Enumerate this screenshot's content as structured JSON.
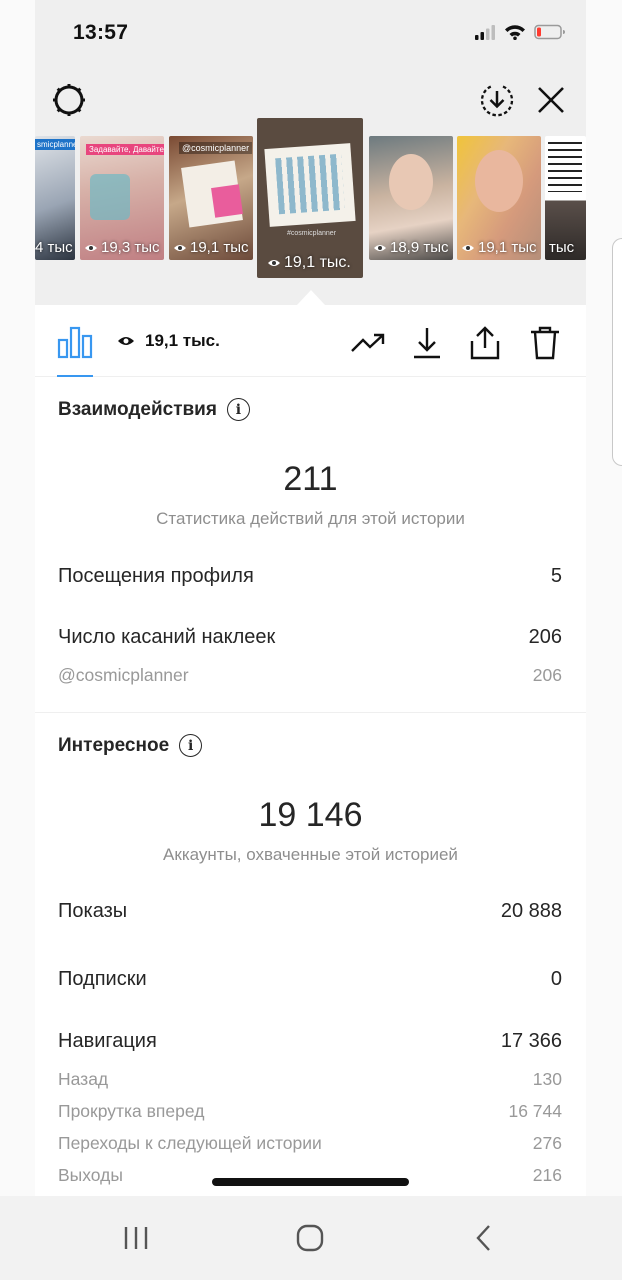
{
  "status_bar": {
    "time": "13:57"
  },
  "icons": {
    "settings": "settings-gear-icon",
    "download_circle": "download-circle-icon",
    "close": "close-icon",
    "signal": "signal-icon",
    "wifi": "wifi-icon",
    "battery": "battery-icon",
    "eye": "eye-icon"
  },
  "thumbnails": [
    {
      "views": "4 тыс",
      "thumb_text": "smicplanner"
    },
    {
      "views": "19,3 тыс",
      "thumb_text": "Задавайте, Давайте!"
    },
    {
      "views": "19,1 тыс",
      "thumb_text": "@cosmicplanner"
    },
    {
      "views": "19,1 тыс.",
      "thumb_text": "#cosmicplanner",
      "selected": true
    },
    {
      "views": "18,9 тыс"
    },
    {
      "views": "19,1 тыс"
    },
    {
      "views": "тыс"
    }
  ],
  "toolbar": {
    "views": "19,1 тыс."
  },
  "interactions": {
    "title": "Взаимодействия",
    "value": "211",
    "caption": "Статистика действий для этой истории",
    "rows": [
      {
        "label": "Посещения профиля",
        "value": "5"
      },
      {
        "label": "Число касаний наклеек",
        "value": "206"
      }
    ],
    "sub_rows": [
      {
        "label": "@cosmicplanner",
        "value": "206"
      }
    ]
  },
  "discovery": {
    "title": "Интересное",
    "value": "19 146",
    "caption": "Аккаунты, охваченные этой историей",
    "rows": [
      {
        "label": "Показы",
        "value": "20 888"
      },
      {
        "label": "Подписки",
        "value": "0"
      },
      {
        "label": "Навигация",
        "value": "17 366"
      }
    ],
    "sub_rows": [
      {
        "label": "Назад",
        "value": "130"
      },
      {
        "label": "Прокрутка вперед",
        "value": "16 744"
      },
      {
        "label": "Переходы к следующей истории",
        "value": "276"
      },
      {
        "label": "Выходы",
        "value": "216"
      }
    ]
  },
  "colors": {
    "accent": "#3897f0",
    "battery_low": "#ff3b30",
    "secondary_text": "#8e8e8e"
  }
}
